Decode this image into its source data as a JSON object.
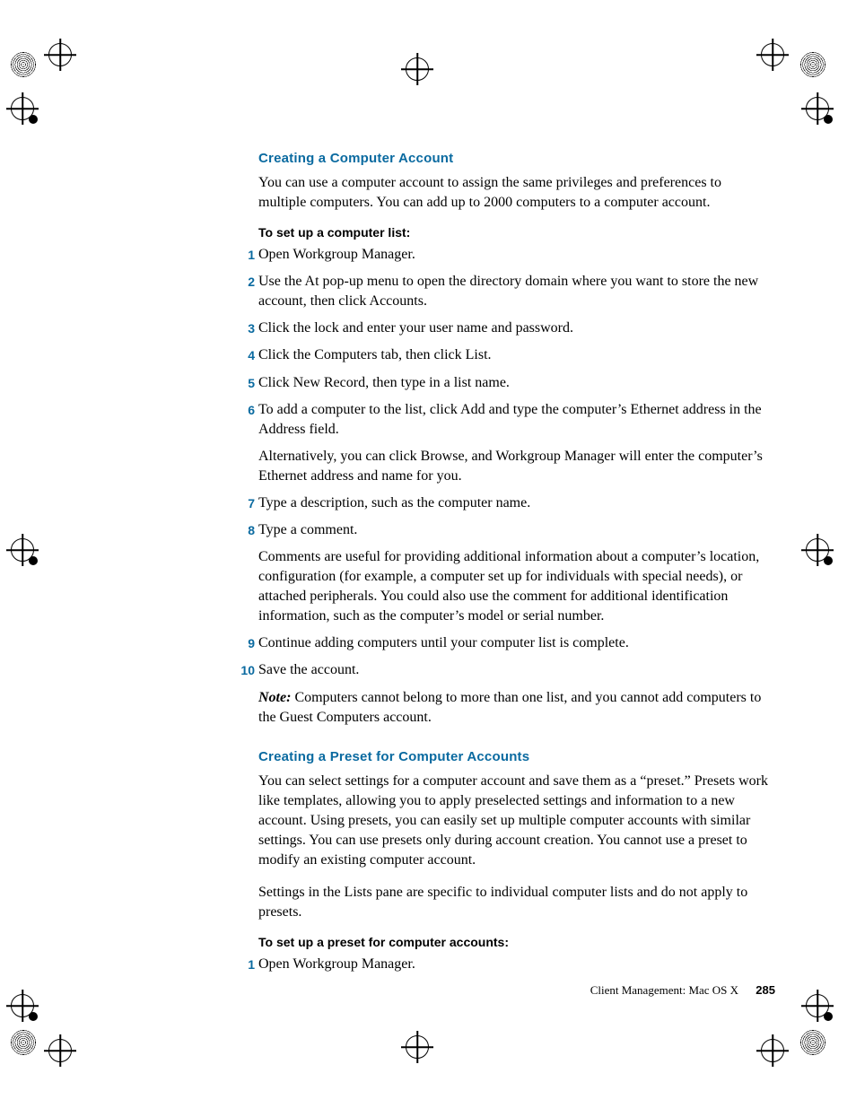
{
  "section1": {
    "heading": "Creating a Computer Account",
    "intro": "You can use a computer account to assign the same privileges and preferences to multiple computers. You can add up to 2000 computers to a computer account.",
    "task_heading": "To set up a computer list:",
    "steps": [
      {
        "n": "1",
        "text": "Open Workgroup Manager."
      },
      {
        "n": "2",
        "text": "Use the At pop-up menu to open the directory domain where you want to store the new account, then click Accounts."
      },
      {
        "n": "3",
        "text": "Click the lock and enter your user name and password."
      },
      {
        "n": "4",
        "text": "Click the Computers tab, then click List."
      },
      {
        "n": "5",
        "text": "Click New Record, then type in a list name."
      },
      {
        "n": "6",
        "text": "To add a computer to the list, click Add and type the computer’s Ethernet address in the Address field.",
        "sub": "Alternatively, you can click Browse, and Workgroup Manager will enter the computer’s Ethernet address and name for you."
      },
      {
        "n": "7",
        "text": "Type a description, such as the computer name."
      },
      {
        "n": "8",
        "text": "Type a comment.",
        "sub": "Comments are useful for providing additional information about a computer’s location, configuration (for example, a computer set up for individuals with special needs), or attached peripherals. You could also use the comment for additional identification information, such as the computer’s model or serial number."
      },
      {
        "n": "9",
        "text": "Continue adding computers until your computer list is complete."
      },
      {
        "n": "10",
        "text": "Save the account.",
        "note_label": "Note:",
        "note_text": "   Computers cannot belong to more than one list, and you cannot add computers to the Guest Computers account."
      }
    ]
  },
  "section2": {
    "heading": "Creating a Preset for Computer Accounts",
    "p1": "You can select settings for a computer account and save them as a “preset.” Presets work like templates, allowing you to apply preselected settings and information to a new account. Using presets, you can easily set up multiple computer accounts with similar settings. You can use presets only during account creation. You cannot use a preset to modify an existing computer account.",
    "p2": "Settings in the Lists pane are specific to individual computer lists and do not apply to presets.",
    "task_heading": "To set up a preset for computer accounts:",
    "steps": [
      {
        "n": "1",
        "text": "Open Workgroup Manager."
      }
    ]
  },
  "footer": {
    "label": "Client Management: Mac OS X",
    "page": "285"
  }
}
